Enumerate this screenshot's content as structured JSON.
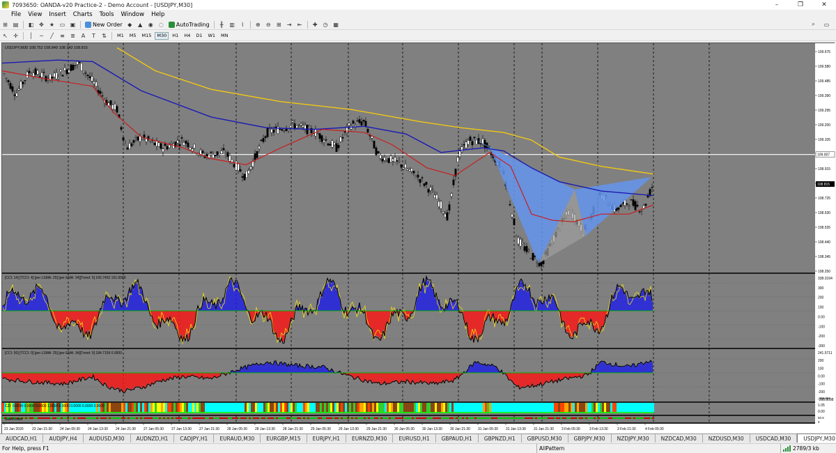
{
  "window": {
    "title": "7093650: OANDA-v20 Practice-2 - Demo Account - [USDJPY,M30]",
    "minimize": "–",
    "restore": "❐",
    "close": "✕"
  },
  "menu": [
    "File",
    "View",
    "Insert",
    "Charts",
    "Tools",
    "Window",
    "Help"
  ],
  "toolbar": {
    "new_order": "New Order",
    "autotrading": "AutoTrading"
  },
  "timeframes": [
    "M1",
    "M5",
    "M15",
    "M30",
    "H1",
    "H4",
    "D1",
    "W1",
    "MN"
  ],
  "selected_timeframe": "M30",
  "chart": {
    "header": "USDJPY,M30  108.752 108.849 108.743 108.815",
    "price_labels": [
      "109.675",
      "109.580",
      "109.485",
      "109.390",
      "109.295",
      "109.200",
      "109.105",
      "109.010",
      "108.915",
      "108.820",
      "108.725",
      "108.630",
      "108.535",
      "108.440",
      "108.345",
      "108.250"
    ],
    "hline_label": "109.007",
    "current_price": "108.815",
    "time_labels": [
      "23 Jan 2020",
      "23 Jan 21:30",
      "24 Jan 05:30",
      "24 Jan 13:30",
      "24 Jan 21:30",
      "27 Jan 05:30",
      "27 Jan 13:30",
      "27 Jan 21:30",
      "28 Jan 05:30",
      "28 Jan 13:30",
      "28 Jan 21:30",
      "29 Jan 05:30",
      "29 Jan 13:30",
      "29 Jan 21:30",
      "30 Jan 05:30",
      "30 Jan 13:30",
      "30 Jan 21:30",
      "31 Jan 05:30",
      "31 Jan 13:30",
      "31 Jan 21:30",
      "3 Feb 05:30",
      "3 Feb 13:30",
      "3 Feb 21:30",
      "4 Feb 05:30"
    ],
    "colors": {
      "bg": "#808080",
      "ma_red": "#c81e1e",
      "ma_blue": "#1a1ab4",
      "ma_yellow": "#f0c814",
      "pattern": "#6495ed",
      "cci_pos": "#2828dc",
      "cci_neg": "#f01e1e",
      "cci_yellow": "#f0dc14"
    }
  },
  "cci1": {
    "header": "[CCI: 14] [TCCI: 4] [per LSMA: 25] [per EMA: 34][Trend: 5]  165.7452 151.0059",
    "labels": [
      "338.3194",
      "300",
      "200",
      "100",
      "0.00",
      "-100",
      "-200",
      "-300"
    ]
  },
  "cci2": {
    "header": "[CCI: 50] [TCCI: 0] [per LSMA: 25] [per EMA: 34][Trend: 5]  184.7159 0.0000",
    "labels": [
      "241.5711",
      "200",
      "100",
      "0.00",
      "-100",
      "-200",
      "-368.8098"
    ],
    "extra_label": "-368.893"
  },
  "cz": {
    "header": "CZI: 0.0000 0.0000 0.0000 1.0000 0.0000 0.0000 0.0000 0.0000",
    "labels": [
      "1.05",
      "0.00"
    ]
  },
  "sw": {
    "header": "SideWinder",
    "labels": [
      "50.5",
      "0"
    ]
  },
  "tabs": [
    "AUDCAD,H1",
    "AUDJPY,H4",
    "AUDUSD,M30",
    "AUDNZD,H1",
    "CADJPY,H1",
    "EURAUD,M30",
    "EURGBP,M15",
    "EURJPY,H1",
    "EURNZD,M30",
    "EURUSD,H1",
    "GBPAUD,H1",
    "GBPNZD,H1",
    "GBPUSD,M30",
    "GBPJPY,M30",
    "NZDJPY,M30",
    "NZDCAD,M30",
    "NZDUSD,M30",
    "USDCAD,M30",
    "USDJPY,M30"
  ],
  "active_tab": "USDJPY,M30",
  "status": {
    "help": "For Help, press F1",
    "template": "AllPattern",
    "connection": "2789/3 kb"
  }
}
